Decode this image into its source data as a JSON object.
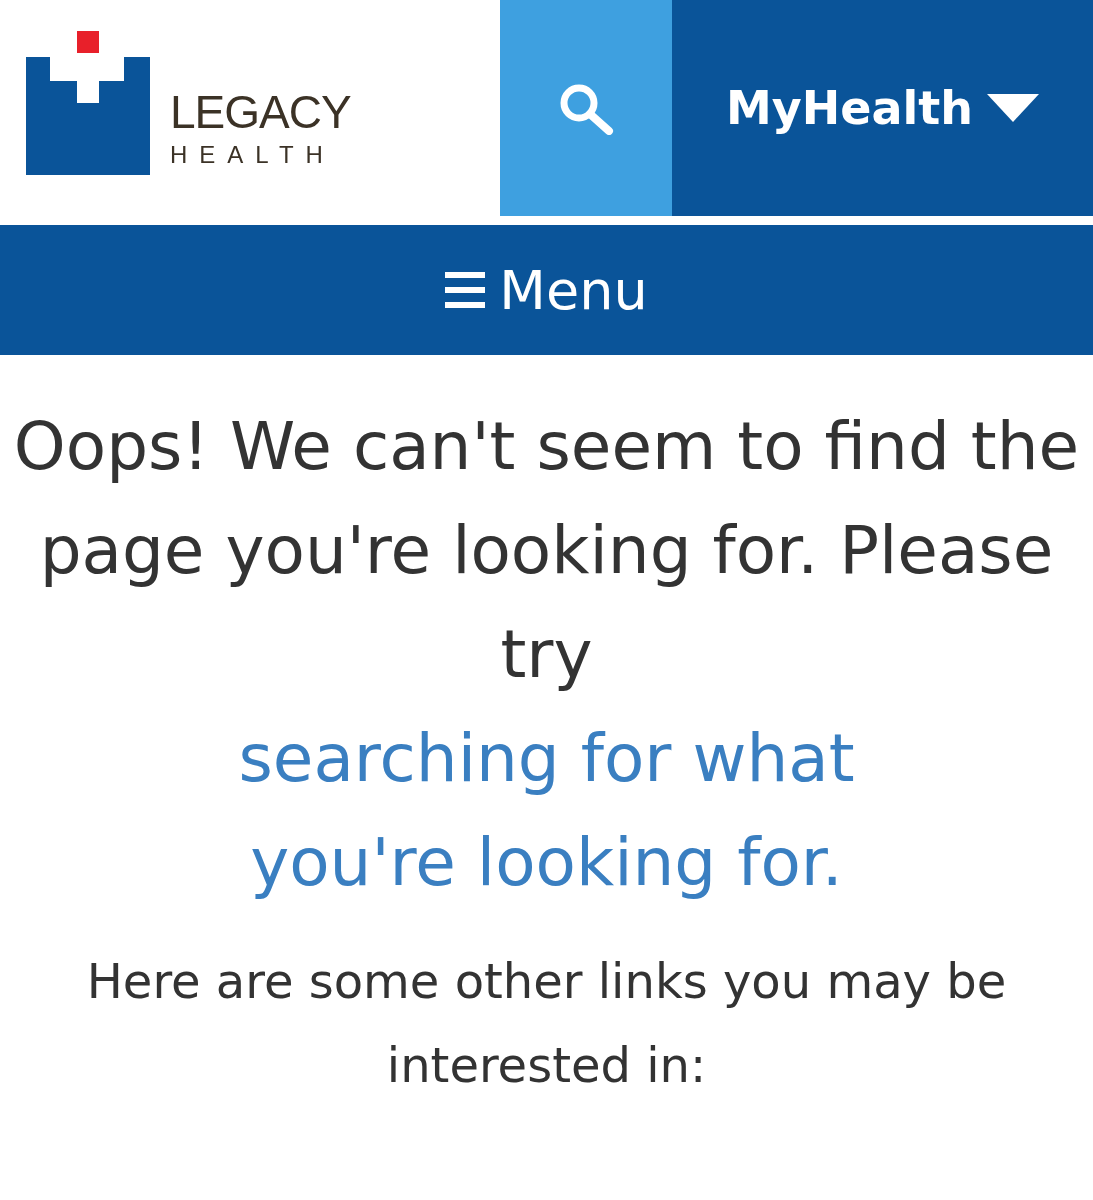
{
  "header": {
    "logo": {
      "name": "LEGACY",
      "subtitle": "HEALTH"
    },
    "myhealth_button": {
      "label": "MyHealth"
    }
  },
  "menu_bar": {
    "label": "Menu"
  },
  "message": {
    "text": "Oops! We can't seem to find the page you're looking for.",
    "prompt": "Please try",
    "link": "searching for what you're looking for."
  },
  "links_intro": "Here are some other links you may be interested in:"
}
